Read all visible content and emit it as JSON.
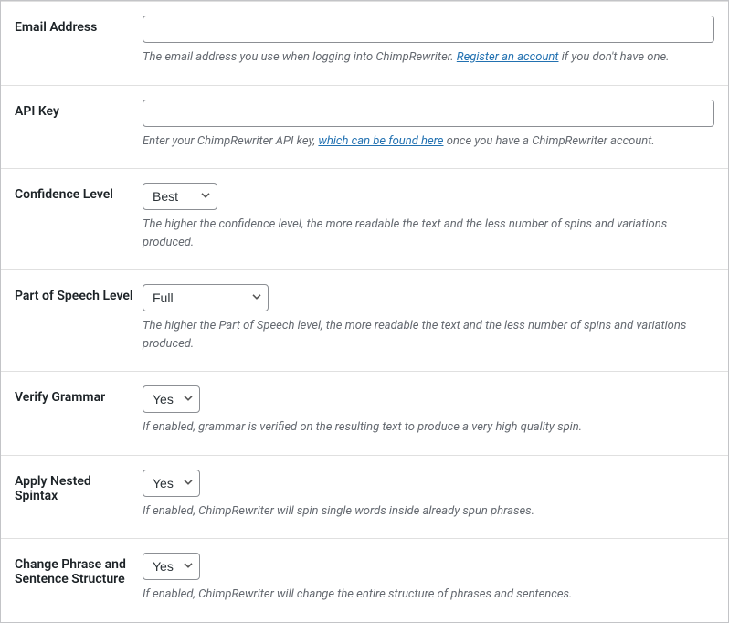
{
  "fields": {
    "email": {
      "label": "Email Address",
      "value": "",
      "desc_before": "The email address you use when logging into ChimpRewriter. ",
      "link_text": "Register an account",
      "desc_after": " if you don't have one."
    },
    "api_key": {
      "label": "API Key",
      "value": "",
      "desc_before": "Enter your ChimpRewriter API key, ",
      "link_text": "which can be found here",
      "desc_after": " once you have a ChimpRewriter account."
    },
    "confidence": {
      "label": "Confidence Level",
      "selected": "Best",
      "desc": "The higher the confidence level, the more readable the text and the less number of spins and variations produced."
    },
    "pos": {
      "label": "Part of Speech Level",
      "selected": "Full",
      "desc": "The higher the Part of Speech level, the more readable the text and the less number of spins and variations produced."
    },
    "grammar": {
      "label": "Verify Grammar",
      "selected": "Yes",
      "desc": "If enabled, grammar is verified on the resulting text to produce a very high quality spin."
    },
    "nested": {
      "label": "Apply Nested Spintax",
      "selected": "Yes",
      "desc": "If enabled, ChimpRewriter will spin single words inside already spun phrases."
    },
    "structure": {
      "label": "Change Phrase and Sentence Structure",
      "selected": "Yes",
      "desc": "If enabled, ChimpRewriter will change the entire structure of phrases and sentences."
    }
  }
}
